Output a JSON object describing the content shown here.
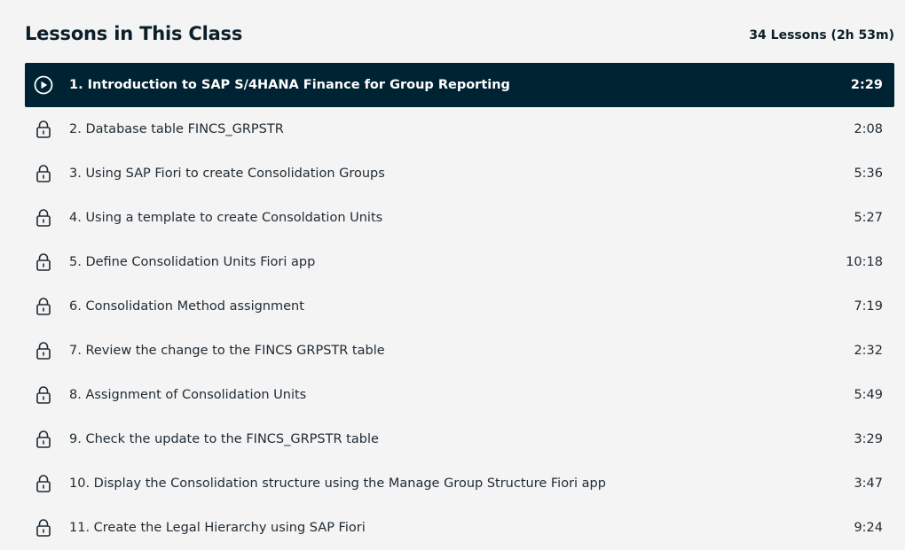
{
  "header": {
    "title": "Lessons in This Class",
    "summary": "34 Lessons (2h 53m)"
  },
  "lessons": [
    {
      "label": "1. Introduction to SAP S/4HANA Finance for Group Reporting",
      "duration": "2:29",
      "icon": "play-icon",
      "active": true
    },
    {
      "label": "2. Database table FINCS_GRPSTR",
      "duration": "2:08",
      "icon": "lock-icon",
      "active": false
    },
    {
      "label": "3. Using SAP Fiori to create Consolidation Groups",
      "duration": "5:36",
      "icon": "lock-icon",
      "active": false
    },
    {
      "label": "4. Using a template to create Consoldation Units",
      "duration": "5:27",
      "icon": "lock-icon",
      "active": false
    },
    {
      "label": "5. Define Consolidation Units Fiori app",
      "duration": "10:18",
      "icon": "lock-icon",
      "active": false
    },
    {
      "label": "6. Consolidation Method assignment",
      "duration": "7:19",
      "icon": "lock-icon",
      "active": false
    },
    {
      "label": "7. Review the change to the FINCS GRPSTR table",
      "duration": "2:32",
      "icon": "lock-icon",
      "active": false
    },
    {
      "label": "8. Assignment of Consolidation Units",
      "duration": "5:49",
      "icon": "lock-icon",
      "active": false
    },
    {
      "label": "9. Check the update to the FINCS_GRPSTR table",
      "duration": "3:29",
      "icon": "lock-icon",
      "active": false
    },
    {
      "label": "10. Display the Consolidation structure using the Manage Group Structure Fiori app",
      "duration": "3:47",
      "icon": "lock-icon",
      "active": false
    },
    {
      "label": "11. Create the Legal Hierarchy using SAP Fiori",
      "duration": "9:24",
      "icon": "lock-icon",
      "active": false
    }
  ],
  "colors": {
    "background": "#f4f4f4",
    "active_row": "#002333",
    "text": "#1f2a33"
  }
}
